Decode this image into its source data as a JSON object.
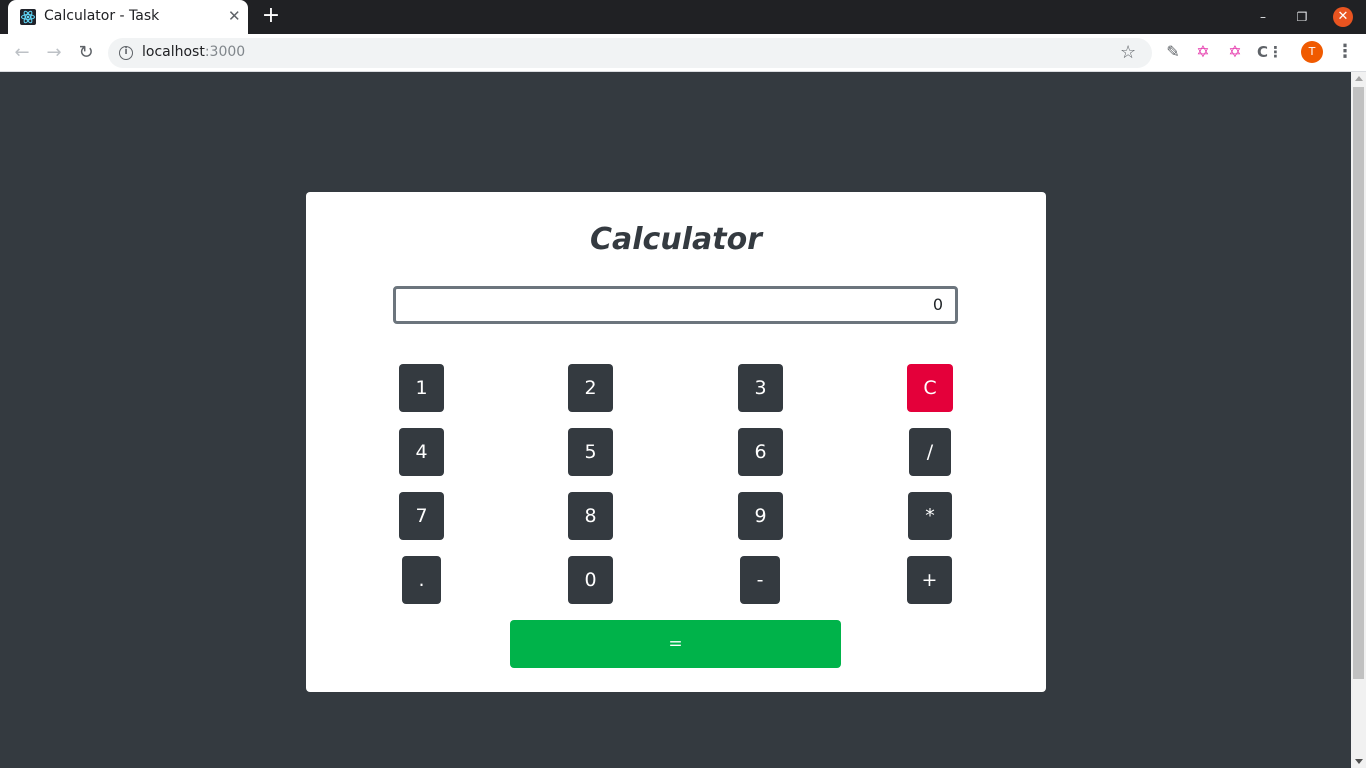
{
  "browser": {
    "tab_title": "Calculator - Task",
    "tab_close": "✕",
    "new_tab": "+",
    "url_host": "localhost",
    "url_port": ":3000",
    "avatar_initial": "T",
    "window_controls": {
      "minimize": "–",
      "maximize": "❐",
      "close": "✕"
    },
    "icons": [
      "back-icon",
      "forward-icon",
      "reload-icon",
      "info-icon",
      "star-icon",
      "eyedropper-extension-icon",
      "graphql-extension-icon",
      "graphql-extension-icon",
      "css-extension-icon",
      "menu-icon"
    ]
  },
  "calculator": {
    "title": "Calculator",
    "display_value": "0",
    "keys": {
      "one": "1",
      "two": "2",
      "three": "3",
      "clear": "C",
      "four": "4",
      "five": "5",
      "six": "6",
      "divide": "/",
      "seven": "7",
      "eight": "8",
      "nine": "9",
      "multiply": "*",
      "dot": ".",
      "zero": "0",
      "minus": "-",
      "plus": "+",
      "equals": "="
    }
  },
  "colors": {
    "background": "#343a40",
    "clear_button": "#e4003a",
    "equals_button": "#00b34a",
    "key_button": "#343a40"
  }
}
